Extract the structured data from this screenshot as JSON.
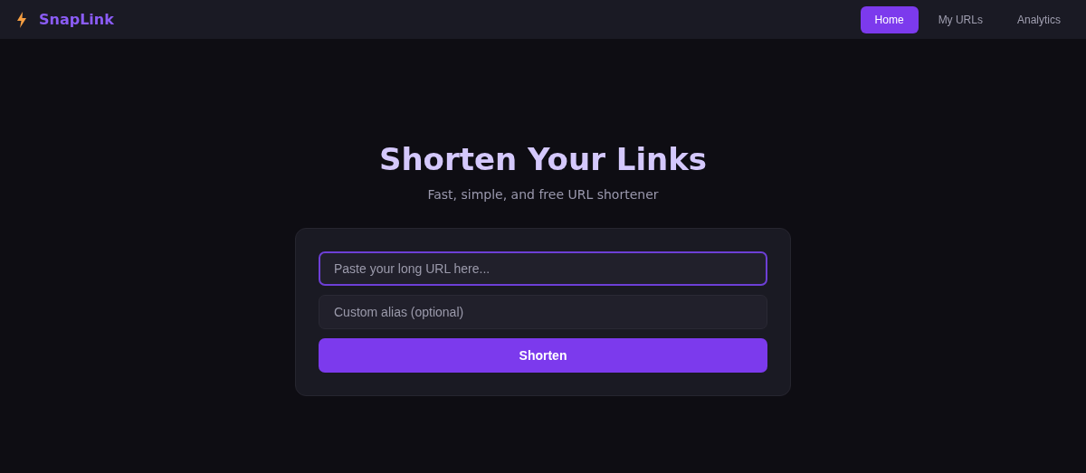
{
  "brand": {
    "name": "SnapLink"
  },
  "nav": [
    {
      "label": "Home",
      "selected": true
    },
    {
      "label": "My URLs",
      "selected": false
    },
    {
      "label": "Analytics",
      "selected": false
    }
  ],
  "hero": {
    "title": "Shorten Your Links",
    "subtitle": "Fast, simple, and free URL shortener"
  },
  "form": {
    "fields": [
      {
        "placeholder": "Paste your long URL here...",
        "focused": true
      },
      {
        "placeholder": "Custom alias (optional)",
        "focused": false
      }
    ],
    "button": "Shorten"
  }
}
